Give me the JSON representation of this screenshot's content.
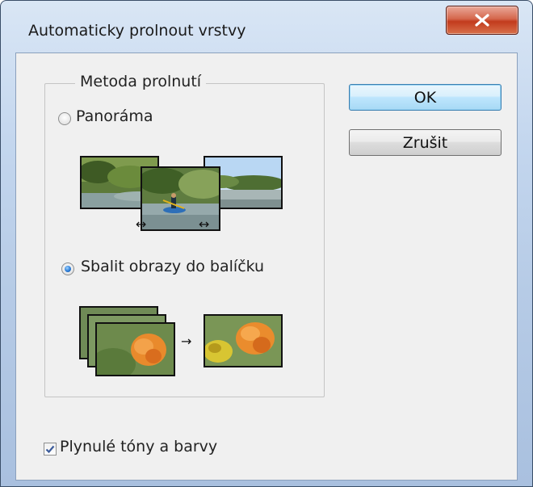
{
  "window": {
    "title": "Automaticky prolnout vrstvy"
  },
  "group": {
    "legend": "Metoda prolnutí"
  },
  "options": {
    "panorama_label": "Panoráma",
    "stack_label": "Sbalit obrazy do balíčku",
    "selected": "stack"
  },
  "buttons": {
    "ok_label": "OK",
    "cancel_label": "Zrušit"
  },
  "checkbox": {
    "label": "Plynulé tóny a barvy",
    "checked": true
  },
  "icons": {
    "close": "close-icon",
    "panorama_arrows": "↔",
    "stack_arrow": "→"
  },
  "colors": {
    "close_red": "#c23b1d",
    "ok_blue": "#bee6fd",
    "radio_dot": "#2a7bd6",
    "window_bg": "#f0f0f0"
  }
}
